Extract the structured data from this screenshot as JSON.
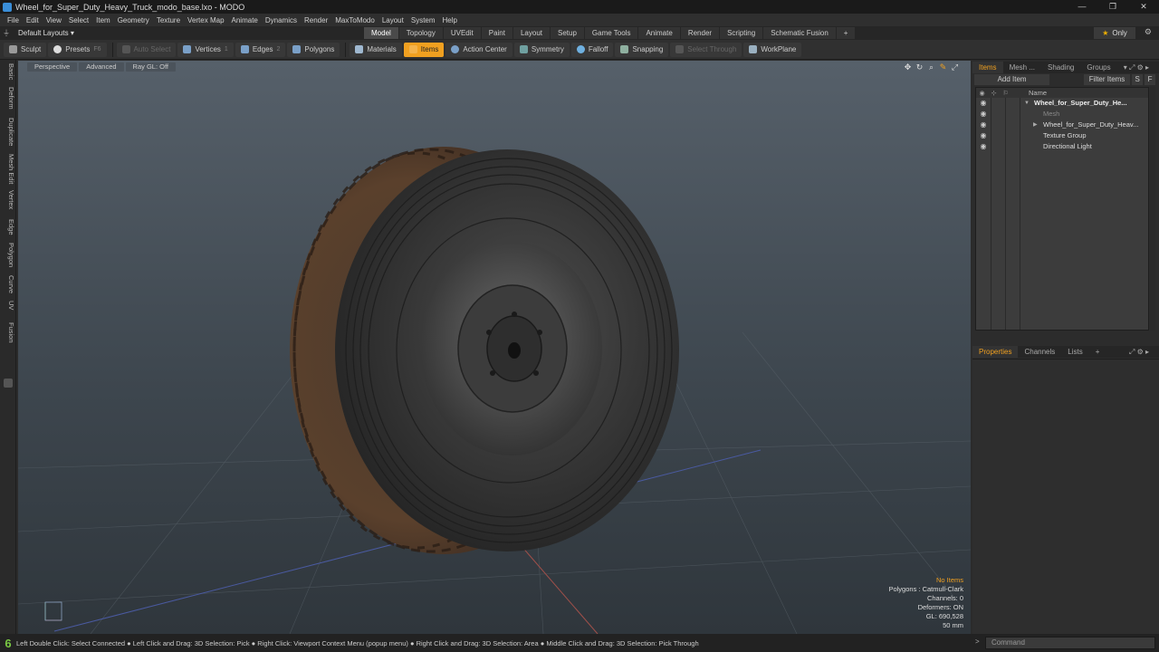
{
  "window": {
    "title": "Wheel_for_Super_Duty_Heavy_Truck_modo_base.lxo - MODO",
    "controls": [
      "—",
      "❐",
      "✕"
    ]
  },
  "menu": [
    "File",
    "Edit",
    "View",
    "Select",
    "Item",
    "Geometry",
    "Texture",
    "Vertex Map",
    "Animate",
    "Dynamics",
    "Render",
    "MaxToModo",
    "Layout",
    "System",
    "Help"
  ],
  "layout": {
    "selector": "Default Layouts ▾",
    "tabs": [
      "Model",
      "Topology",
      "UVEdit",
      "Paint",
      "Layout",
      "Setup",
      "Game Tools",
      "Animate",
      "Render",
      "Scripting",
      "Schematic Fusion",
      "+"
    ],
    "active_tab": "Model",
    "only_label": "Only"
  },
  "toolbar": {
    "sculpt": "Sculpt",
    "presets": "Presets",
    "presets_key": "F6",
    "auto_select": "Auto Select",
    "vertices": "Vertices",
    "vertices_key": "1",
    "edges": "Edges",
    "edges_key": "2",
    "polygons": "Polygons",
    "materials": "Materials",
    "items": "Items",
    "action_center": "Action Center",
    "symmetry": "Symmetry",
    "falloff": "Falloff",
    "snapping": "Snapping",
    "select_through": "Select Through",
    "workplane": "WorkPlane"
  },
  "left_tabs": [
    "Basic",
    "Deform",
    "Duplicate",
    "Mesh Edit",
    "Vertex",
    "Edge",
    "Polygon",
    "Curve",
    "UV",
    "Fusion"
  ],
  "viewport": {
    "tabs": [
      "Perspective",
      "Advanced",
      "Ray GL: Off"
    ],
    "info": {
      "no_items": "No Items",
      "polygons": "Polygons : Catmull-Clark",
      "channels": "Channels: 0",
      "deformers": "Deformers: ON",
      "gl": "GL: 690,528",
      "focal": "50 mm"
    }
  },
  "panel_top": {
    "tabs": [
      "Items",
      "Mesh ...",
      "Shading",
      "Groups"
    ],
    "active": "Items",
    "add_item": "Add Item",
    "filter_items": "Filter Items",
    "s_btn": "S",
    "f_btn": "F",
    "name_header": "Name",
    "items": [
      {
        "label": "Wheel_for_Super_Duty_He...",
        "level": 0,
        "bold": true
      },
      {
        "label": "Mesh",
        "level": 1,
        "faded": true
      },
      {
        "label": "Wheel_for_Super_Duty_Heav...",
        "level": 1
      },
      {
        "label": "Texture Group",
        "level": 1
      },
      {
        "label": "Directional Light",
        "level": 1
      }
    ]
  },
  "panel_bottom": {
    "tabs": [
      "Properties",
      "Channels",
      "Lists",
      "+"
    ],
    "active": "Properties"
  },
  "status": {
    "badge": "6",
    "hint": "Left Double Click: Select Connected ● Left Click and Drag: 3D Selection: Pick ● Right Click: Viewport Context Menu (popup menu) ● Right Click and Drag: 3D Selection: Area ● Middle Click and Drag: 3D Selection: Pick Through",
    "command_placeholder": "Command"
  }
}
